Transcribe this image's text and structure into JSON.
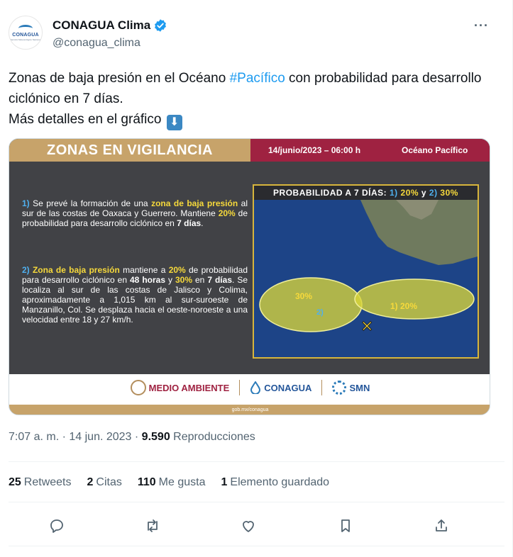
{
  "account": {
    "display_name": "CONAGUA Clima",
    "handle": "@conagua_clima",
    "avatar_logo_text": "CONAGUA",
    "avatar_logo_subtext": "Servicio Meteorológico Nacional",
    "more_label": "···"
  },
  "tweet": {
    "text_before_hashtag": "Zonas de baja presión en el Océano ",
    "hashtag": "#Pacífico",
    "text_after_hashtag": " con probabilidad para desarrollo ciclónico en 7 días.",
    "line2": "Más detalles en el gráfico",
    "emoji": "⬇"
  },
  "card": {
    "title": "ZONAS EN VIGILANCIA",
    "date": "14/junio/2023 – 06:00 h",
    "region": "Océano Pacífico",
    "para1": {
      "num": "1)",
      "t1": " Se prevé la formación de una ",
      "hl1": "zona de baja presión",
      "t2": " al sur de las costas de Oaxaca y Guerrero. Mantiene ",
      "hl2": "20%",
      "t3": " de probabilidad para desarrollo ciclónico en ",
      "hl3": "7 días",
      "t4": "."
    },
    "para2": {
      "num": "2)",
      "hl1": "Zona de baja presión",
      "t1": " mantiene a ",
      "hl2": "20%",
      "t2": " de probabilidad para desarrollo ciclónico en ",
      "hl3": "48 horas",
      "t3": " y ",
      "hl4": "30%",
      "t4": " en ",
      "hl5": "7 días",
      "t5": ". Se localiza al sur de las costas de Jalisco y Colima, aproximadamente a 1,015 km al sur-suroeste de Manzanillo, Col. Se desplaza hacia el oeste-noroeste a una velocidad entre 18 y 27 km/h."
    },
    "map": {
      "title_prefix": "PROBABILIDAD A 7 DÍAS: ",
      "z1_num": "1)",
      "z1_pct": "20%",
      "and": " y ",
      "z2_num": "2)",
      "z2_pct": "30%",
      "zone2_label_pct": "30%",
      "zone2_label_num": "2)",
      "zone1_label": "1) 20%",
      "marker": "✕"
    },
    "footer": {
      "logo1": "MEDIO AMBIENTE",
      "logo2": "CONAGUA",
      "logo3": "SMN",
      "url": "gob.mx/conagua"
    },
    "colors": {
      "gold": "#c7a36a",
      "guinda": "#9f2241",
      "panel": "#414246",
      "highlight_yellow": "#f6d93b",
      "highlight_blue": "#4fb0ef",
      "zone_fill": "#d9d53a"
    }
  },
  "meta": {
    "time": "7:07 a. m.",
    "sep1": " · ",
    "date": "14 jun. 2023",
    "sep2": " · ",
    "views": "9.590",
    "views_label": " Reproducciones"
  },
  "stats": [
    {
      "count": "25",
      "label": "Retweets"
    },
    {
      "count": "2",
      "label": "Citas"
    },
    {
      "count": "110",
      "label": "Me gusta"
    },
    {
      "count": "1",
      "label": "Elemento guardado"
    }
  ],
  "actions": [
    "reply-icon",
    "retweet-icon",
    "like-icon",
    "bookmark-icon",
    "share-icon"
  ]
}
